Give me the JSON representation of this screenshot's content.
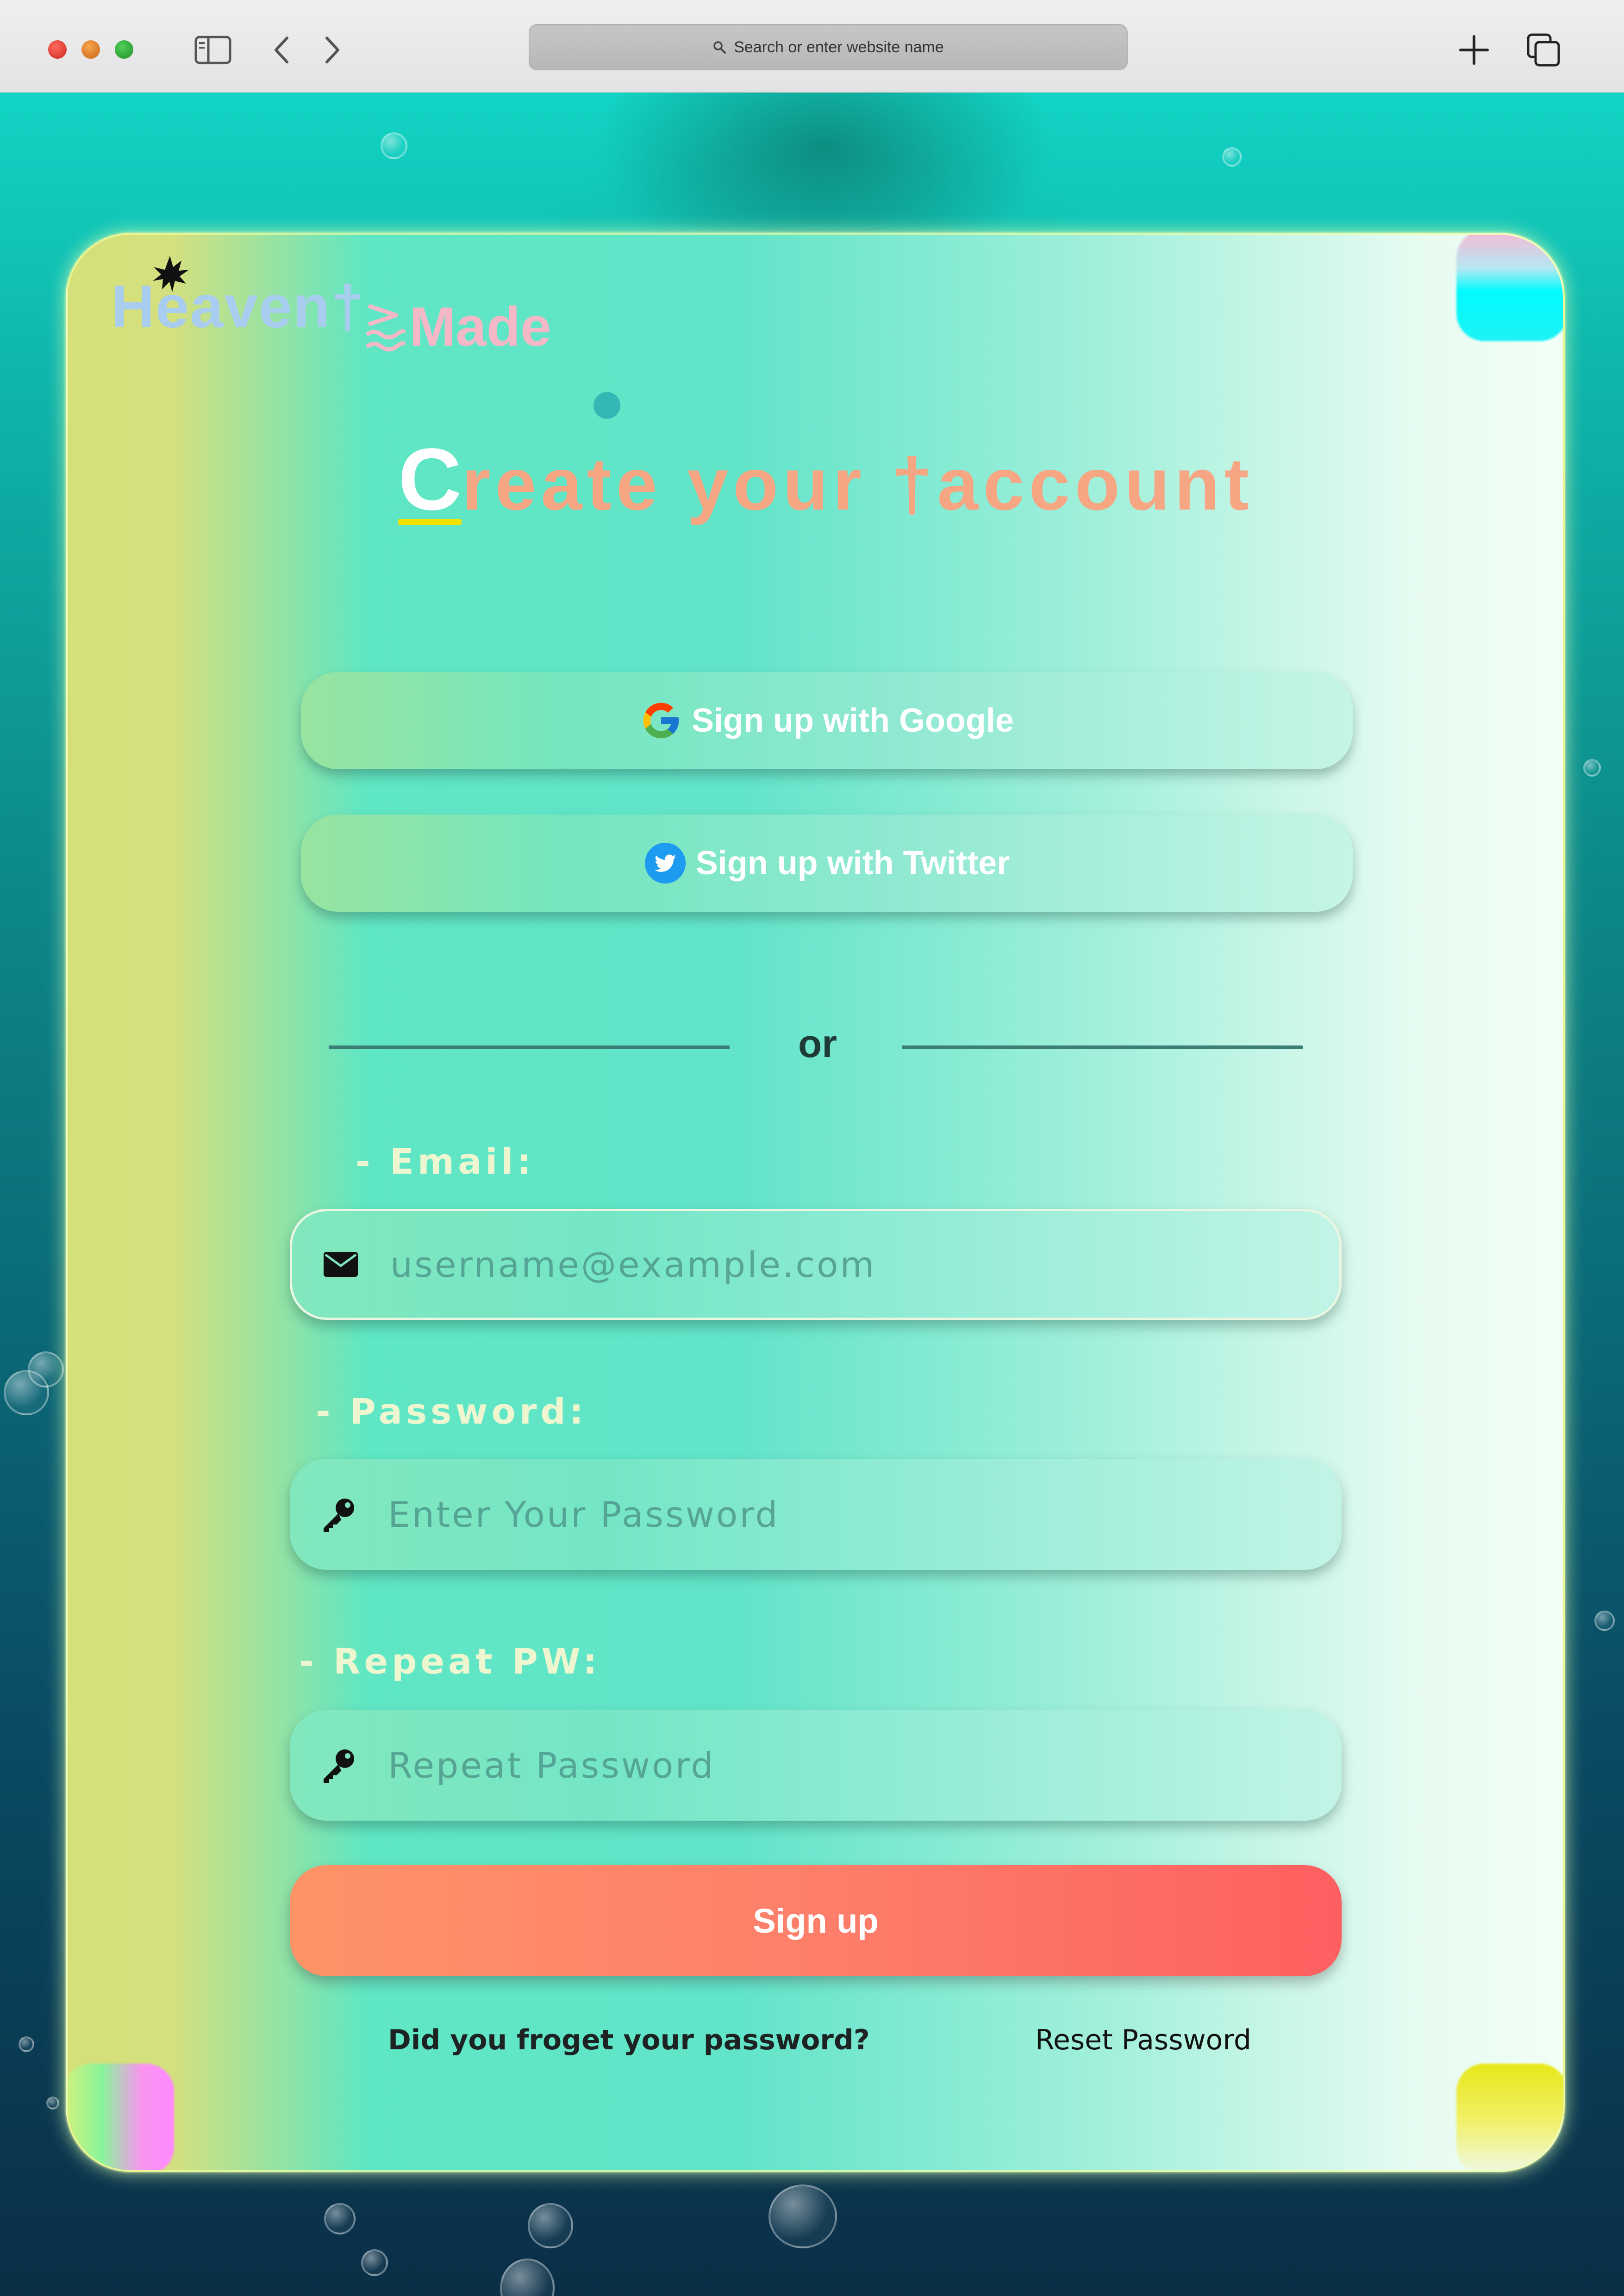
{
  "browser": {
    "address_placeholder": "Search or enter website name"
  },
  "logo": {
    "part1": "Heaven†",
    "part2": "Made"
  },
  "heading": {
    "first_letter": "C",
    "rest": "reate your †account"
  },
  "social": {
    "google_label": "Sign up with Google",
    "twitter_label": "Sign up with Twitter"
  },
  "divider": {
    "text": "or"
  },
  "form": {
    "email_label": "- Email:",
    "email_placeholder": "username@example.com",
    "password_label": "- Password:",
    "password_placeholder": "Enter Your Password",
    "repeat_label": "- Repeat PW:",
    "repeat_placeholder": "Repeat Password",
    "submit_label": "Sign up"
  },
  "footer": {
    "forgot_text": "Did you froget your password?",
    "reset_link": "Reset Password"
  },
  "colors": {
    "heading_accent": "#f7a683",
    "signup_gradient_start": "#fe9367",
    "signup_gradient_end": "#fd5f60",
    "logo_heaven": "#a9cdef",
    "logo_made": "#f4b8c6"
  },
  "icons": {
    "leaf": "leaf-icon",
    "waves": "waves-icon",
    "google": "google-icon",
    "twitter": "twitter-icon",
    "email": "envelope-icon",
    "password": "key-icon",
    "repeat_password": "key-icon"
  }
}
